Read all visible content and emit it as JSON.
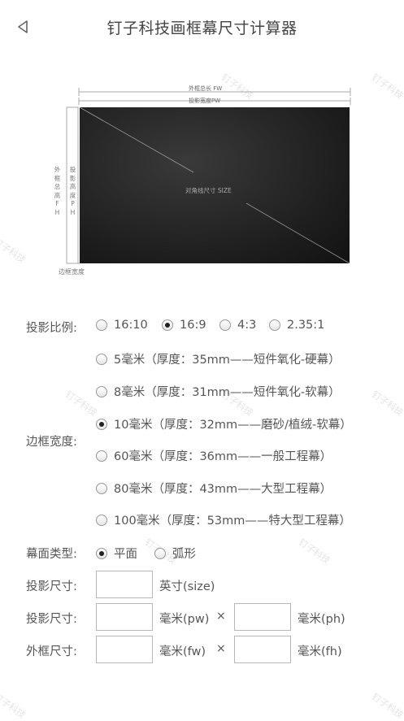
{
  "header": {
    "title": "钉子科技画框幕尺寸计算器"
  },
  "diagram": {
    "outer_width_label": "外框总长 FW",
    "proj_width_label": "投影宽度PW",
    "diag_label": "对角线尺寸 SIZE",
    "outer_height_label": "外框总高FH",
    "proj_height_label": "投影高度PH",
    "frame_width_label": "边框宽度"
  },
  "ratio": {
    "label": "投影比例:",
    "options": [
      "16:10",
      "16:9",
      "4:3",
      "2.35:1"
    ],
    "selected": "16:9"
  },
  "frame": {
    "label": "边框宽度:",
    "options": [
      "5毫米（厚度：35mm——短件氧化-硬幕）",
      "8毫米（厚度：31mm——短件氧化-软幕）",
      "10毫米（厚度：32mm——磨砂/植绒-软幕）",
      "60毫米（厚度：36mm——一般工程幕）",
      "80毫米（厚度：43mm——大型工程幕）",
      "100毫米（厚度：53mm——特大型工程幕）"
    ],
    "selected": "10毫米（厚度：32mm——磨砂/植绒-软幕）"
  },
  "screen_type": {
    "label": "幕面类型:",
    "options": [
      "平面",
      "弧形"
    ],
    "selected": "平面"
  },
  "size_row": {
    "label": "投影尺寸:",
    "unit": "英寸(size)",
    "value": ""
  },
  "proj_row": {
    "label": "投影尺寸:",
    "unit_w": "毫米(pw)",
    "times": "×",
    "unit_h": "毫米(ph)",
    "value_w": "",
    "value_h": ""
  },
  "outer_row": {
    "label": "外框尺寸:",
    "unit_w": "毫米(fw)",
    "times": "×",
    "unit_h": "毫米(fh)",
    "value_w": "",
    "value_h": ""
  },
  "watermark": "钉子科技"
}
